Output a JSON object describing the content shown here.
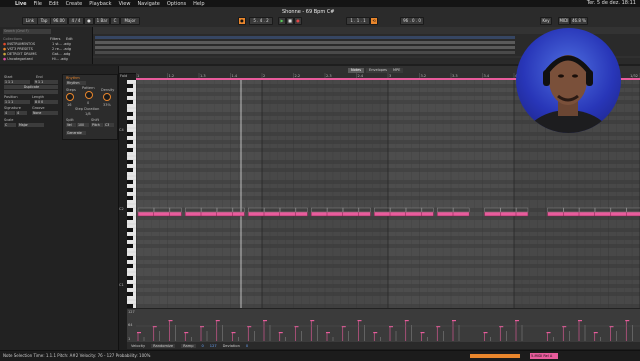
{
  "menubar": {
    "app": "Live",
    "items": [
      "File",
      "Edit",
      "Create",
      "Playback",
      "View",
      "Navigate",
      "Options",
      "Help"
    ],
    "clock": "Ter. 5 de dez. 18:11"
  },
  "transport": {
    "link": "Link",
    "tap": "Tap",
    "tempo": "96.00",
    "meter": "4 / 4",
    "quantize": "1 Bar",
    "key": "C",
    "scale": "Major",
    "position": "5 . 4 . 2",
    "song_title": "Shonne - 69 Bpm C#",
    "loop_start": "1 . 1 . 1",
    "loop_len": "96 . 0 . 0",
    "key_label": "Key",
    "midi_label": "MIDI",
    "cpu": "46.8 %",
    "colors": {
      "accent": "#e9862c",
      "clip": "#e85c9c",
      "cam_bg": "#2836b8"
    }
  },
  "browser": {
    "search_placeholder": "Search (Cmd F)",
    "collections_label": "Collections",
    "collections": [
      {
        "name": "INSTRUMENTOS",
        "color": "#e0492a"
      },
      {
        "name": "VST3 PRESETS",
        "color": "#e9862c"
      },
      {
        "name": "DETROIT DRUMS",
        "color": "#c9a43a"
      },
      {
        "name": "Uncategorized",
        "color": "#d94fa0"
      }
    ],
    "filters_label": "Filters",
    "edit_label": "Edit",
    "files": [
      "1 st... .adg",
      "2 re... .adg",
      "Gat... .adg",
      "Hi... .adg"
    ]
  },
  "clip": {
    "name": "Clip",
    "tabs": {
      "notes": "Notes",
      "envelopes": "Envelopes",
      "mpe": "MPE"
    },
    "panel": {
      "start": "Start",
      "end": "End",
      "duplicate": "Duplicate",
      "position": "Position",
      "length": "Length",
      "signature": "Signature",
      "groove": "Groove",
      "sig_num": "4",
      "sig_den": "4",
      "groove_val": "None",
      "scale_label": "Scale",
      "scale_key": "C",
      "scale_name": "Major",
      "start_val": "1 1 1",
      "end_val": "9 1 1",
      "pos_val": "1 1 1",
      "len_val": "8 0 0"
    },
    "rhythm": {
      "title": "Rhythm",
      "mode": "Rhythm",
      "steps": "Steps",
      "pattern": "Pattern",
      "density": "Density",
      "steps_val": "16",
      "pattern_val": "0",
      "density_val": "33%",
      "step_duration": "Step Duration",
      "step_duration_val": "1/8",
      "split": "Split",
      "shift": "Shift",
      "velocity": "Vel",
      "velocity_val": "100",
      "pitch": "Pitch",
      "pitch_val": "C3",
      "apply": "Generate"
    },
    "ruler": [
      "1",
      "1.2",
      "1.3",
      "1.4",
      "2",
      "2.2",
      "2.3",
      "2.4",
      "3",
      "3.2",
      "3.3",
      "3.4",
      "4",
      "4.2",
      "4.3",
      "4.4",
      "5"
    ],
    "ruler_right": "1/32",
    "fold": "Fold",
    "octaves": [
      "C4",
      "C2",
      "C1"
    ]
  },
  "notes": [
    {
      "start": 0.0,
      "len": 0.27
    },
    {
      "start": 0.5,
      "len": 0.27
    },
    {
      "start": 1.0,
      "len": 0.2
    },
    {
      "start": 1.5,
      "len": 0.27
    },
    {
      "start": 2.0,
      "len": 0.27
    },
    {
      "start": 2.5,
      "len": 0.27
    },
    {
      "start": 3.0,
      "len": 0.2
    },
    {
      "start": 3.5,
      "len": 0.27
    },
    {
      "start": 4.0,
      "len": 0.27
    },
    {
      "start": 4.5,
      "len": 0.27
    },
    {
      "start": 5.0,
      "len": 0.2
    },
    {
      "start": 5.5,
      "len": 0.27
    },
    {
      "start": 6.0,
      "len": 0.27
    },
    {
      "start": 6.5,
      "len": 0.27
    },
    {
      "start": 7.0,
      "len": 0.2
    },
    {
      "start": 7.5,
      "len": 0.27
    },
    {
      "start": 8.0,
      "len": 0.27
    },
    {
      "start": 8.5,
      "len": 0.27
    },
    {
      "start": 9.0,
      "len": 0.2
    },
    {
      "start": 9.5,
      "len": 0.27
    },
    {
      "start": 10.0,
      "len": 0.27
    },
    {
      "start": 11.0,
      "len": 0.27
    },
    {
      "start": 11.5,
      "len": 0.27
    },
    {
      "start": 12.0,
      "len": 0.2
    },
    {
      "start": 13.0,
      "len": 0.27
    },
    {
      "start": 13.5,
      "len": 0.27
    },
    {
      "start": 14.0,
      "len": 0.27
    },
    {
      "start": 14.5,
      "len": 0.27
    },
    {
      "start": 15.0,
      "len": 0.27
    },
    {
      "start": 15.5,
      "len": 0.27
    }
  ],
  "velocity_lane": {
    "max_label": "127",
    "mid_label": "64",
    "min_label": "1"
  },
  "bottombar": {
    "velocity_lbl": "Velocity",
    "randomize": "Randomize",
    "ramp": "Ramp",
    "ramp_val": "0",
    "vel": "127",
    "deviation": "Deviation",
    "dev_val": "0"
  },
  "status": {
    "text": "Note Selection   Time: 1.1.1   Pitch: A#2   Velocity: 76 - 127   Probability: 100%",
    "track": "5-MIDI Rel A"
  }
}
